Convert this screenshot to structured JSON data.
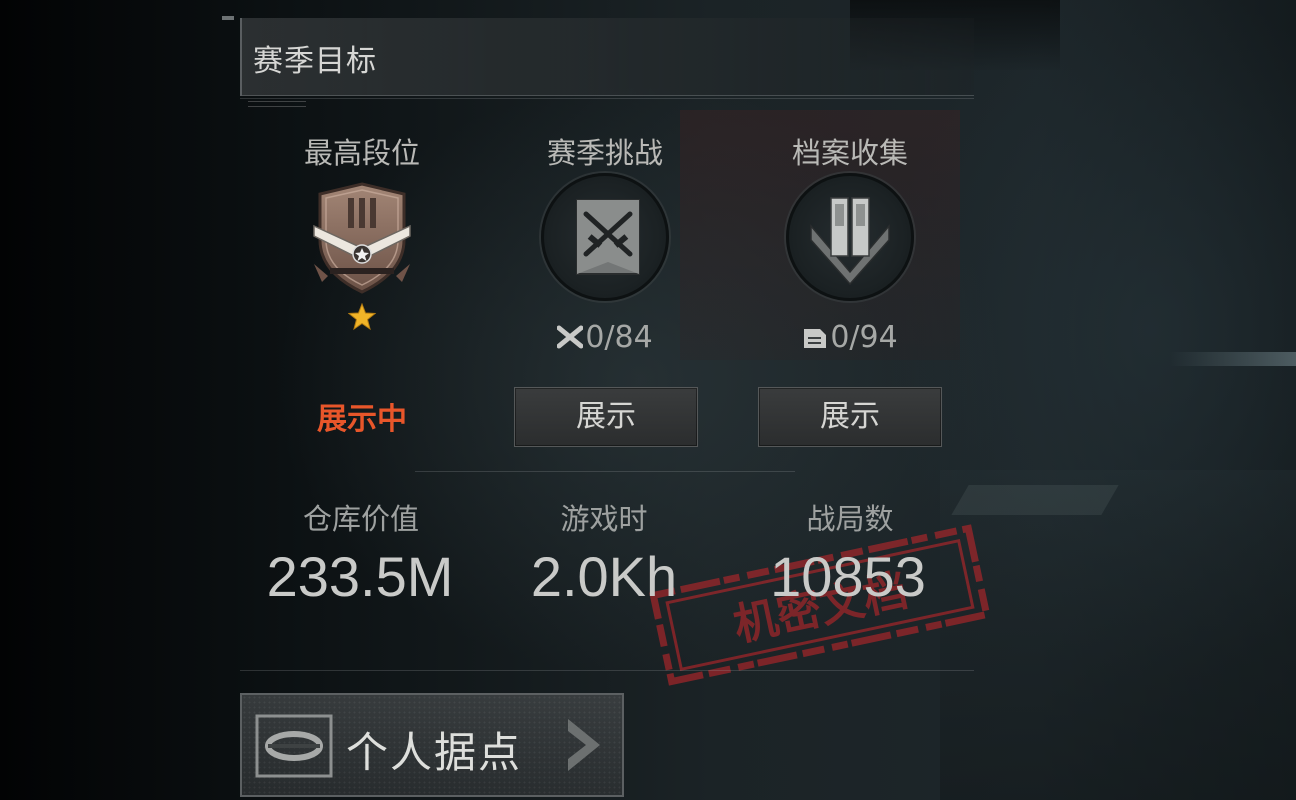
{
  "panel": {
    "title": "赛季目标"
  },
  "goals": [
    {
      "heading": "最高段位",
      "rank_stars": 1,
      "status": "展示中",
      "emblem": "rank-shield-icon"
    },
    {
      "heading": "赛季挑战",
      "counter": "0/84",
      "counter_icon": "challenge-cross-icon",
      "button": "展示",
      "emblem": "crossed-guns-icon"
    },
    {
      "heading": "档案收集",
      "counter": "0/94",
      "counter_icon": "document-icon",
      "button": "展示",
      "emblem": "archive-chevron-icon"
    }
  ],
  "stats": [
    {
      "label": "仓库价值",
      "value": "233.5M"
    },
    {
      "label": "游戏时",
      "value": "2.0Kh"
    },
    {
      "label": "战局数",
      "value": "10853"
    }
  ],
  "stamp": {
    "text": "机密文档"
  },
  "base_button": {
    "label": "个人据点"
  },
  "colors": {
    "status_active": "#e8562a",
    "star": "#f0b428",
    "stamp_red": "#b8262a"
  }
}
